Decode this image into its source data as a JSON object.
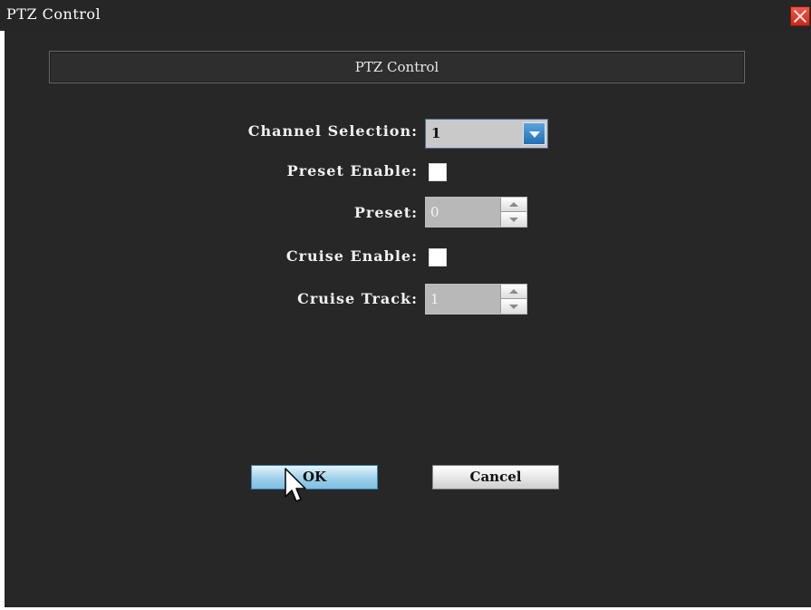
{
  "window": {
    "title": "PTZ Control"
  },
  "header": {
    "title": "PTZ Control"
  },
  "form": {
    "channel_selection": {
      "label": "Channel Selection:",
      "value": "1"
    },
    "preset_enable": {
      "label": "Preset Enable:",
      "checked": false
    },
    "preset": {
      "label": "Preset:",
      "value": "0"
    },
    "cruise_enable": {
      "label": "Cruise Enable:",
      "checked": false
    },
    "cruise_track": {
      "label": "Cruise Track:",
      "value": "1"
    }
  },
  "buttons": {
    "ok_label": "OK",
    "cancel_label": "Cancel"
  },
  "icons": {
    "close": "close-icon",
    "dropdown": "chevron-down-icon",
    "spin_up": "chevron-up-icon",
    "spin_down": "chevron-down-icon",
    "cursor": "mouse-pointer-icon"
  },
  "colors": {
    "background": "#272727",
    "titlebar": "#262626",
    "accent": "#1f6fb5",
    "ok_button": "#9fd0ea",
    "close": "#c8291b"
  }
}
